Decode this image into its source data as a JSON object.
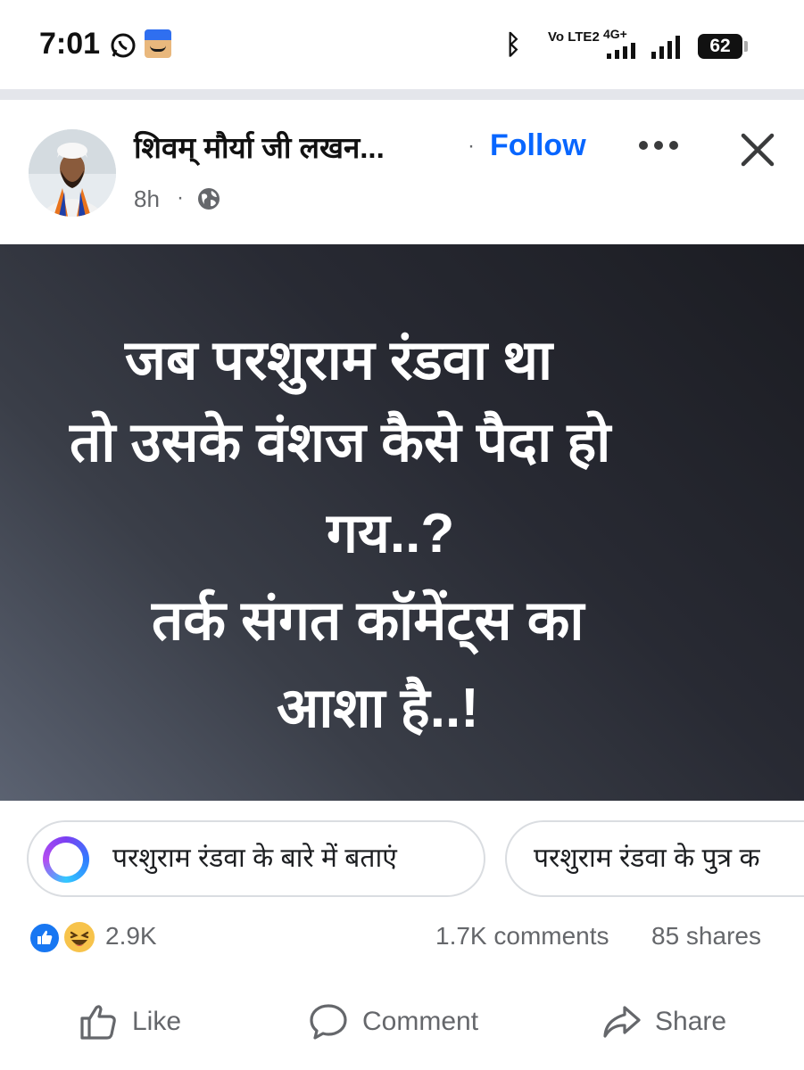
{
  "status_bar": {
    "time": "7:01",
    "battery": "62",
    "network_label_1": "Vo LTE2",
    "network_label_2": "4G+",
    "icons": [
      "whatsapp-icon",
      "amazon-icon",
      "bluetooth-icon",
      "signal-icon",
      "battery-icon"
    ]
  },
  "post": {
    "author": "शिवम् मौर्या जी लखन...",
    "separator": "·",
    "follow_label": "Follow",
    "time": "8h",
    "meta_separator": "·",
    "privacy_icon": "globe-icon",
    "image_text_lines": [
      "जब परशुराम रंडवा था",
      "तो उसके वंशज कैसे पैदा हो",
      "गय..?",
      "तर्क संगत कॉमेंट्स का",
      "आशा है..!"
    ]
  },
  "ai_suggestions": [
    "परशुराम रंडवा के बारे में बताएं",
    "परशुराम रंडवा के पुत्र क"
  ],
  "stats": {
    "reactions": "2.9K",
    "comments": "1.7K comments",
    "shares": "85 shares"
  },
  "actions": {
    "like": "Like",
    "comment": "Comment",
    "share": "Share"
  },
  "colors": {
    "accent": "#0866ff",
    "secondary_text": "#65676b",
    "image_bg_dark": "#1b1c22",
    "image_bg_light": "#5b6271"
  }
}
